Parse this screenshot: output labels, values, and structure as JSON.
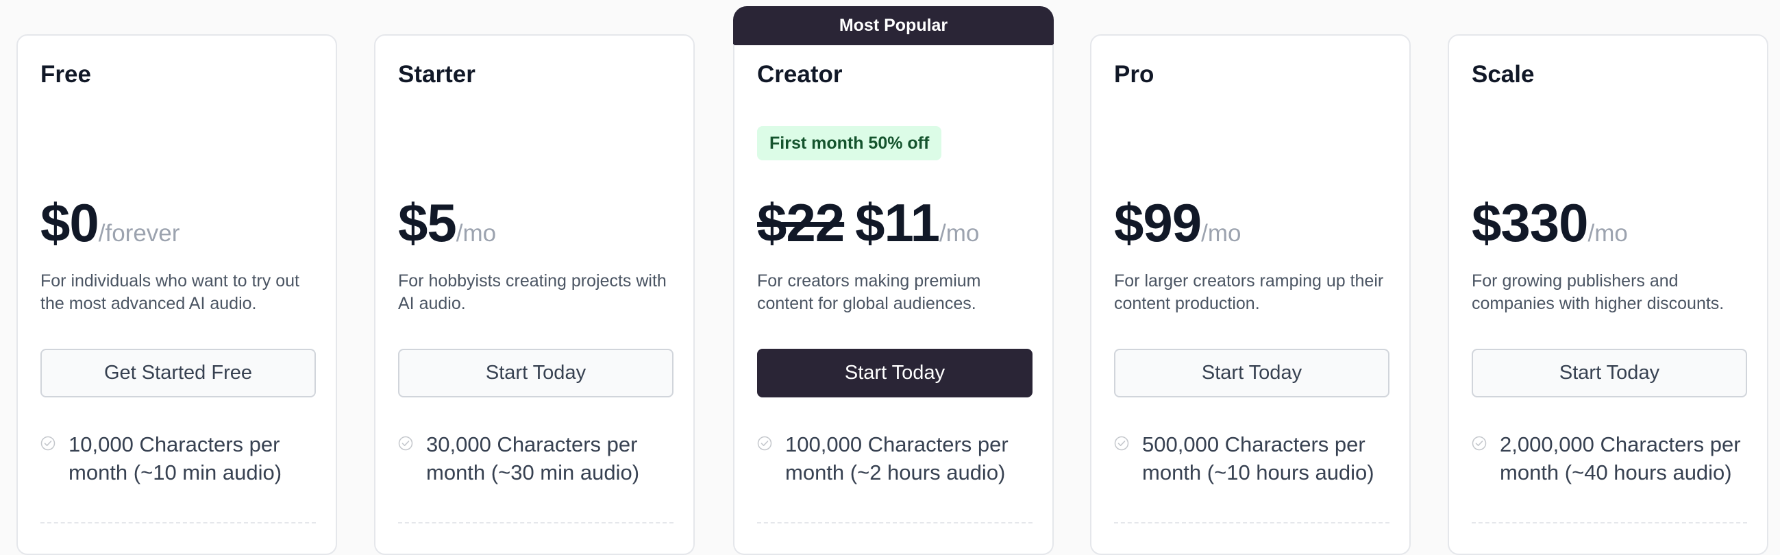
{
  "popular_label": "Most Popular",
  "colors": {
    "accent": "#2a2536",
    "promo_bg": "#dcfce7",
    "muted": "#9ca3af"
  },
  "plans": [
    {
      "name": "Free",
      "price": "$0",
      "period": "/forever",
      "description": "For individuals who want to try out the most advanced AI audio.",
      "cta": "Get Started Free",
      "feature": "10,000 Characters per month (~10 min audio)",
      "feature_icon": "check-circle-icon"
    },
    {
      "name": "Starter",
      "price": "$5",
      "period": "/mo",
      "description": "For hobbyists creating projects with AI audio.",
      "cta": "Start Today",
      "feature": "30,000 Characters per month (~30 min audio)",
      "feature_icon": "check-circle-icon"
    },
    {
      "name": "Creator",
      "promo": "First month 50% off",
      "old_price": "$22",
      "price": "$11",
      "period": "/mo",
      "description": "For creators making premium content for global audiences.",
      "cta": "Start Today",
      "feature": "100,000 Characters per month (~2 hours audio)",
      "feature_icon": "check-circle-icon"
    },
    {
      "name": "Pro",
      "price": "$99",
      "period": "/mo",
      "description": "For larger creators ramping up their content production.",
      "cta": "Start Today",
      "feature": "500,000 Characters per month (~10 hours audio)",
      "feature_icon": "check-circle-icon"
    },
    {
      "name": "Scale",
      "price": "$330",
      "period": "/mo",
      "description": "For growing publishers and companies with higher discounts.",
      "cta": "Start Today",
      "feature": "2,000,000 Characters per month (~40 hours audio)",
      "feature_icon": "check-circle-icon"
    }
  ]
}
